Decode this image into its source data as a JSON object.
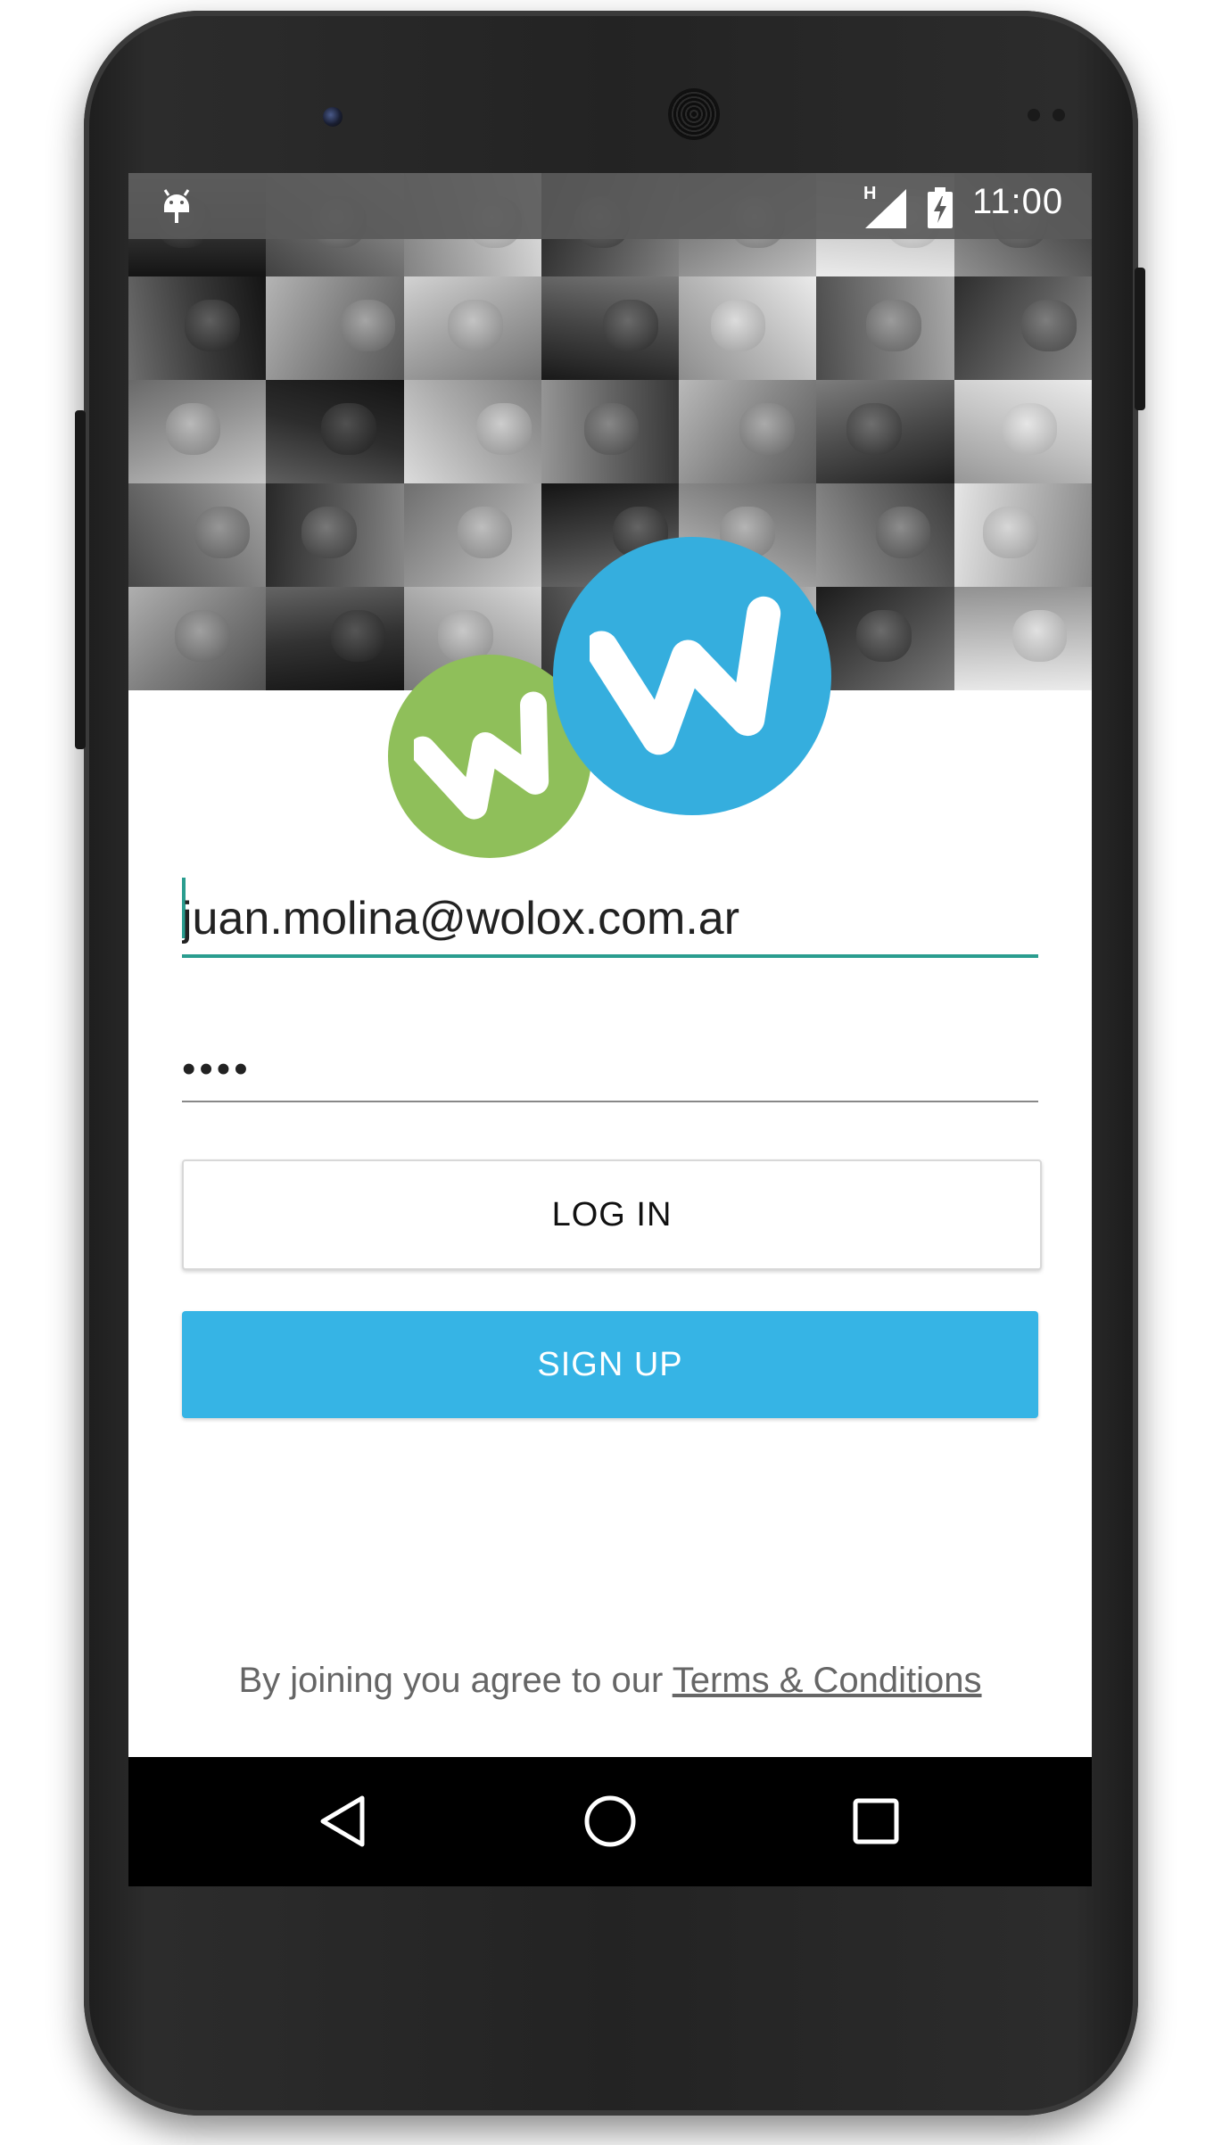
{
  "status_bar": {
    "network_type": "H",
    "time": "11:00",
    "icons": [
      "android-notification-icon",
      "signal-icon",
      "battery-charging-icon"
    ]
  },
  "logo": {
    "letters": [
      "w",
      "W"
    ],
    "colors": {
      "green": "#8fbf5a",
      "blue": "#35aede"
    }
  },
  "login_form": {
    "email_value": "juan.molina@wolox.com.ar",
    "password_value": "••••",
    "login_label": "LOG IN",
    "signup_label": "SIGN UP"
  },
  "footer": {
    "terms_prefix": "By joining you agree to our ",
    "terms_link": "Terms & Conditions"
  },
  "navigation_bar": {
    "icons": [
      "back-icon",
      "home-icon",
      "recents-icon"
    ]
  },
  "theme": {
    "accent": "#2a9d8f",
    "signup_color": "#36b4e5",
    "background": "#ffffff"
  }
}
